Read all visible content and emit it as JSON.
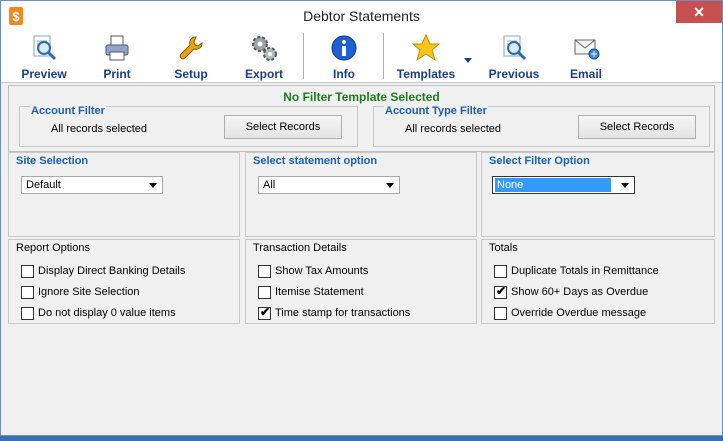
{
  "window": {
    "title": "Debtor Statements",
    "close_glyph": "✕"
  },
  "toolbar": {
    "buttons": [
      {
        "label": "Preview",
        "icon": "preview-icon"
      },
      {
        "label": "Print",
        "icon": "printer-icon"
      },
      {
        "label": "Setup",
        "icon": "wrench-icon"
      },
      {
        "label": "Export",
        "icon": "gears-icon"
      },
      {
        "label": "Info",
        "icon": "info-icon"
      },
      {
        "label": "Templates",
        "icon": "star-icon"
      },
      {
        "label": "Previous",
        "icon": "previous-icon"
      },
      {
        "label": "Email",
        "icon": "email-icon"
      }
    ]
  },
  "filter_panel": {
    "status": "No Filter Template Selected",
    "account_filter": {
      "title": "Account Filter",
      "text": "All records selected",
      "button": "Select Records"
    },
    "account_type_filter": {
      "title": "Account Type Filter",
      "text": "All records selected",
      "button": "Select Records"
    }
  },
  "site_selection": {
    "title": "Site Selection",
    "value": "Default"
  },
  "statement_option": {
    "title": "Select statement option",
    "value": "All"
  },
  "filter_option": {
    "title": "Select Filter Option",
    "value": "None"
  },
  "report_options": {
    "title": "Report Options",
    "items": [
      {
        "label": "Display Direct Banking Details",
        "checked": false
      },
      {
        "label": "Ignore Site Selection",
        "checked": false
      },
      {
        "label": "Do not display 0 value items",
        "checked": false
      }
    ]
  },
  "transaction_details": {
    "title": "Transaction Details",
    "items": [
      {
        "label": "Show Tax Amounts",
        "checked": false
      },
      {
        "label": "Itemise Statement",
        "checked": false
      },
      {
        "label": "Time stamp for transactions",
        "checked": true
      }
    ]
  },
  "totals": {
    "title": "Totals",
    "items": [
      {
        "label": "Duplicate Totals in Remittance",
        "checked": false
      },
      {
        "label": "Show 60+ Days as Overdue",
        "checked": true
      },
      {
        "label": "Override Overdue message",
        "checked": false
      }
    ]
  },
  "check_glyph": "✔",
  "colors": {
    "accent_blue": "#1a5fb4",
    "status_green": "#1f7a1f",
    "close_red": "#c75050",
    "selection_blue": "#3399ff"
  }
}
